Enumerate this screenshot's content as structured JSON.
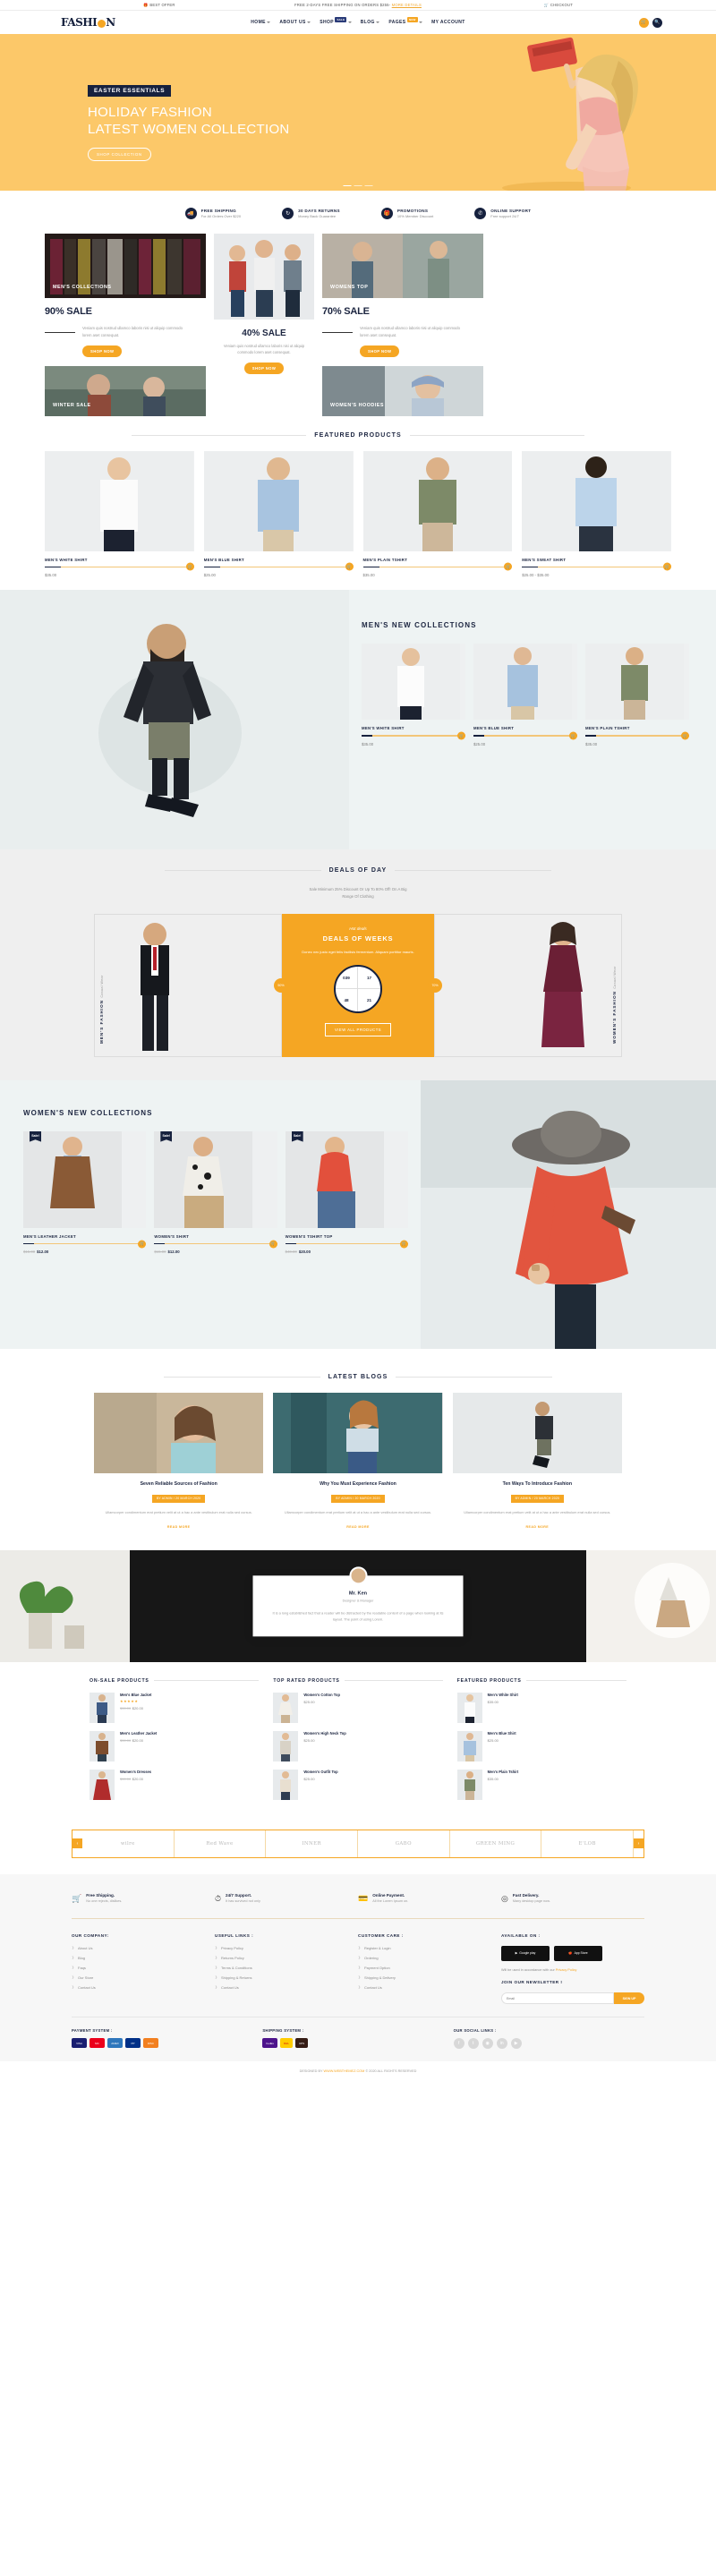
{
  "topbar": {
    "best_offer": "BEST OFFER",
    "shipping_notice": "FREE 2-DAYS FREE SHIPPING ON ORDERS $255-",
    "more_details": "MORE DETAILS",
    "checkout": "CHECKOUT"
  },
  "header": {
    "logo_pre": "FASHI",
    "logo_post": "N",
    "nav": [
      {
        "label": "HOME",
        "caret": true,
        "badge": null
      },
      {
        "label": "ABOUT US",
        "caret": true,
        "badge": null
      },
      {
        "label": "SHOP",
        "caret": true,
        "badge": "SALE"
      },
      {
        "label": "BLOG",
        "caret": true,
        "badge": null
      },
      {
        "label": "PAGES",
        "caret": true,
        "badge": "NEW"
      },
      {
        "label": "MY ACCOUNT",
        "caret": false,
        "badge": null
      }
    ],
    "cart_icon": "cart-icon",
    "search_icon": "search-icon"
  },
  "hero": {
    "eyebrow": "EASTER ESSENTIALS",
    "line1": "HOLIDAY FASHION",
    "line2": "LATEST WOMEN COLLECTION",
    "button": "SHOP COLLECTION"
  },
  "features": [
    {
      "icon": "truck-icon",
      "title": "FREE SHIPPING",
      "sub": "For All Orders Over $220"
    },
    {
      "icon": "refresh-icon",
      "title": "30 DAYS RETURNS",
      "sub": "Money Back Guarantee"
    },
    {
      "icon": "gift-icon",
      "title": "PROMOTIONS",
      "sub": "10% Member Discount"
    },
    {
      "icon": "phone-icon",
      "title": "ONLINE SUPPORT",
      "sub": "Free support 24/7"
    }
  ],
  "collections": {
    "left_tile_caption": "MEN'S COLLECTIONS",
    "left_title": "90% SALE",
    "left_text": "Veniam quis nostrud ullamco laboris nisi ut aliquip commodo lorem aset consequat.",
    "left_button": "SHOP NOW",
    "bottom_left_caption": "WINTER SALE",
    "center_title": "40% SALE",
    "center_text": "Veniam quis nostrud ullamco laboris nisi ut aliquip commodo lorem aset consequat.",
    "center_button": "SHOP NOW",
    "right_tile_caption": "WOMENS TOP",
    "right_title": "70% SALE",
    "right_text": "Veniam quis nostrud ullamco laboris nisi ut aliquip commodo lorem aset consequat.",
    "right_button": "SHOP NOW",
    "bottom_right_caption": "WOMEN'S HOODIES"
  },
  "featured": {
    "heading": "FEATURED PRODUCTS",
    "products": [
      {
        "name": "MEN'S WHITE SHIRT",
        "price": "$35.00"
      },
      {
        "name": "MEN'S BLUE SHIRT",
        "price": "$25.00"
      },
      {
        "name": "MEN'S PLAIN TSHIRT",
        "price": "$35.00"
      },
      {
        "name": "MEN'S SWEAT SHIRT",
        "price": "$25.00 - $35.00"
      }
    ]
  },
  "mens_new": {
    "heading": "MEN'S NEW COLLECTIONS",
    "products": [
      {
        "name": "MEN'S WHITE SHIRT",
        "price": "$35.00"
      },
      {
        "name": "MEN'S BLUE SHIRT",
        "price": "$25.00"
      },
      {
        "name": "MEN'S PLAIN TSHIRT",
        "price": "$35.00"
      }
    ]
  },
  "deals": {
    "heading": "DEALS OF DAY",
    "sub_line1": "Sale Minimum 25% Discount Or Up To 80% Off! On A Big",
    "sub_line2": "Range Of Clothing",
    "left_vertical": "MEN'S FASHION",
    "left_vertical_sub": "Casual Wear",
    "right_vertical": "WOMEN'S FASHION",
    "right_vertical_sub": "Casual Wear",
    "left_pill": "50%",
    "right_pill": "70%",
    "hot": "Hot deals",
    "title": "DEALS OF WEEKS",
    "text": "Donec nec justo eget felis facilisis fermentum. Aliquam porttitor mauris.",
    "clock": {
      "days": "039",
      "hours": "17",
      "minutes": "48",
      "seconds": "21"
    },
    "button": "VIEW ALL PRODUCTS"
  },
  "womens_new": {
    "heading": "WOMEN'S NEW COLLECTIONS",
    "products": [
      {
        "name": "MEN'S LEATHER JACKET",
        "old": "$15.00",
        "price": "$12.00",
        "ribbon": "Sale!"
      },
      {
        "name": "WOMEN'S SHIRT",
        "old": "$15.00",
        "price": "$12.00",
        "ribbon": "Sale!"
      },
      {
        "name": "WOMEN'S TSHIRT TOP",
        "old": "$40.00",
        "price": "$20.00",
        "ribbon": "Sale!"
      }
    ]
  },
  "blogs": {
    "heading": "LATEST BLOGS",
    "posts": [
      {
        "title": "Seven Reliable Sources of Fashion",
        "meta": "BY ADMIN / 20 MARCH 2020",
        "text": "Ullamcorper condimentum erat pretium velit at ut a hac a ante vestibulum erat nulla sed cursus.",
        "more": "READ MORE"
      },
      {
        "title": "Why You Must Experience Fashion",
        "meta": "BY ADMIN / 20 MARCH 2020",
        "text": "Ullamcorper condimentum erat pretium velit at ut a hac a ante vestibulum erat nulla sed cursus.",
        "more": "READ MORE"
      },
      {
        "title": "Ten Ways To Introduce Fashion",
        "meta": "BY ADMIN / 20 MARCH 2020",
        "text": "Ullamcorper condimentum erat pretium velit at ut a hac a ante vestibulum erat nulla sed cursus.",
        "more": "READ MORE"
      }
    ]
  },
  "testimonial": {
    "name": "Mr. Ken",
    "role": "Designer & Manager",
    "quote": "It is a long established fact that a reader will be distracted by the readable content of a page when looking at its layout. The point of using Lorem."
  },
  "lists": [
    {
      "heading": "ON-SALE PRODUCTS",
      "items": [
        {
          "name": "Men's Blue Jacket",
          "stars": "★★★★★",
          "old": "$30.00",
          "price": "$20.00"
        },
        {
          "name": "Men's Leather Jacket",
          "stars": "",
          "old": "$30.00",
          "price": "$20.00"
        },
        {
          "name": "Women's Dresses",
          "stars": "",
          "old": "$30.00",
          "price": "$20.00"
        }
      ]
    },
    {
      "heading": "TOP RATED PRODUCTS",
      "items": [
        {
          "name": "Women's Cotton Top",
          "stars": "",
          "old": "",
          "price": "$25.00"
        },
        {
          "name": "Women's High Neck Top",
          "stars": "",
          "old": "",
          "price": "$25.00"
        },
        {
          "name": "Women's Outfit Top",
          "stars": "",
          "old": "",
          "price": "$25.00"
        }
      ]
    },
    {
      "heading": "FEATURED PRODUCTS",
      "items": [
        {
          "name": "Men's White Shirt",
          "stars": "",
          "old": "",
          "price": "$35.00"
        },
        {
          "name": "Men's Blue Shirt",
          "stars": "",
          "old": "",
          "price": "$25.00"
        },
        {
          "name": "Men's Plain Tshirt",
          "stars": "",
          "old": "",
          "price": "$35.00"
        }
      ]
    }
  ],
  "brands": [
    "wilre",
    "Red Wave",
    "INNER",
    "GABO",
    "GREEN MING",
    "E'LOB"
  ],
  "footer": {
    "services": [
      {
        "icon": "cart-icon",
        "title": "Free Shipping.",
        "sub": "No one rejects, dislikes."
      },
      {
        "icon": "clock-icon",
        "title": "24/7 Support.",
        "sub": "It has survived not only"
      },
      {
        "icon": "payment-icon",
        "title": "Online Payment.",
        "sub": "All the Lorem Ipsum on."
      },
      {
        "icon": "delivery-icon",
        "title": "Fast Delivery.",
        "sub": "Many desktop page now."
      }
    ],
    "columns": [
      {
        "heading": "OUR COMPANY:",
        "links": [
          "About Us",
          "Blog",
          "Faqs",
          "Our Store",
          "Contact Us"
        ]
      },
      {
        "heading": "USEFUL LINKS :",
        "links": [
          "Privacy Policy",
          "Returns Policy",
          "Terms & Conditions",
          "Shipping & Returns",
          "Contact Us"
        ]
      },
      {
        "heading": "CUSTOMER CARE :",
        "links": [
          "Register & Login",
          "Ordering",
          "Payment Option",
          "Shipping & Delivery",
          "Contact Us"
        ]
      }
    ],
    "available": {
      "heading": "AVAILABLE ON :",
      "google": "Google play",
      "apple": "App Store",
      "note": "Will be used in accordance with our",
      "note_link": "Privacy Policy",
      "newsletter_heading": "JOIN OUR NEWSLETTER !",
      "newsletter_placeholder": "Email",
      "newsletter_button": "SIGN UP"
    },
    "bottom": {
      "payment_heading": "PAYMENT SYSTEM :",
      "cards": [
        "VISA",
        "MC",
        "AMEX",
        "PP",
        "DISC"
      ],
      "shipping_heading": "SHIPPING SYSTEM :",
      "shippers": [
        "FedEx",
        "DHL",
        "UPS"
      ],
      "social_heading": "OUR SOCIAL LINKS :",
      "socials": [
        "facebook-icon",
        "twitter-icon",
        "instagram-icon",
        "linkedin-icon",
        "youtube-icon"
      ]
    },
    "copyright_pre": "DESIGNED BY ",
    "copyright_link": "WWW.WEBTHEMEZ.COM",
    "copyright_post": " © 2020 ALL RIGHTS RESERVED"
  }
}
